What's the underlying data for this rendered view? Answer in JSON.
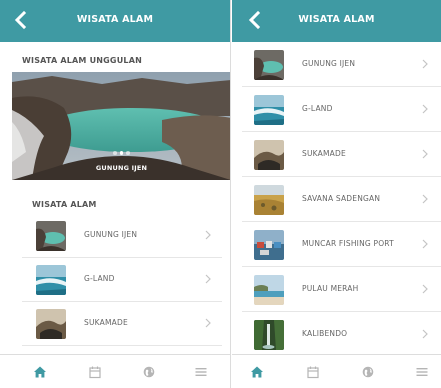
{
  "left_screen": {
    "header": {
      "title": "WISATA ALAM",
      "back_icon": "chevron-left-icon"
    },
    "featured": {
      "section_title": "WISATA ALAM UNGGULAN",
      "caption": "GUNUNG IJEN",
      "slide_count": 3,
      "active_slide": 1
    },
    "list": {
      "section_title": "WISATA ALAM",
      "items": [
        {
          "label": "GUNUNG IJEN"
        },
        {
          "label": "G-LAND"
        },
        {
          "label": "SUKAMADE"
        }
      ]
    }
  },
  "right_screen": {
    "header": {
      "title": "WISATA ALAM",
      "back_icon": "chevron-left-icon"
    },
    "items": [
      {
        "label": "GUNUNG IJEN"
      },
      {
        "label": "G-LAND"
      },
      {
        "label": "SUKAMADE"
      },
      {
        "label": "SAVANA SADENGAN"
      },
      {
        "label": "MUNCAR FISHING PORT"
      },
      {
        "label": "PULAU MERAH"
      },
      {
        "label": "KALIBENDO"
      }
    ]
  },
  "tabbar": {
    "tabs": [
      {
        "icon": "home-icon",
        "active": true
      },
      {
        "icon": "calendar-icon",
        "active": false
      },
      {
        "icon": "globe-icon",
        "active": false
      },
      {
        "icon": "menu-icon",
        "active": false
      }
    ]
  },
  "colors": {
    "header": "#3f9aa3",
    "active_tab": "#3f9aa3",
    "inactive_tab": "#b5b5b5"
  }
}
